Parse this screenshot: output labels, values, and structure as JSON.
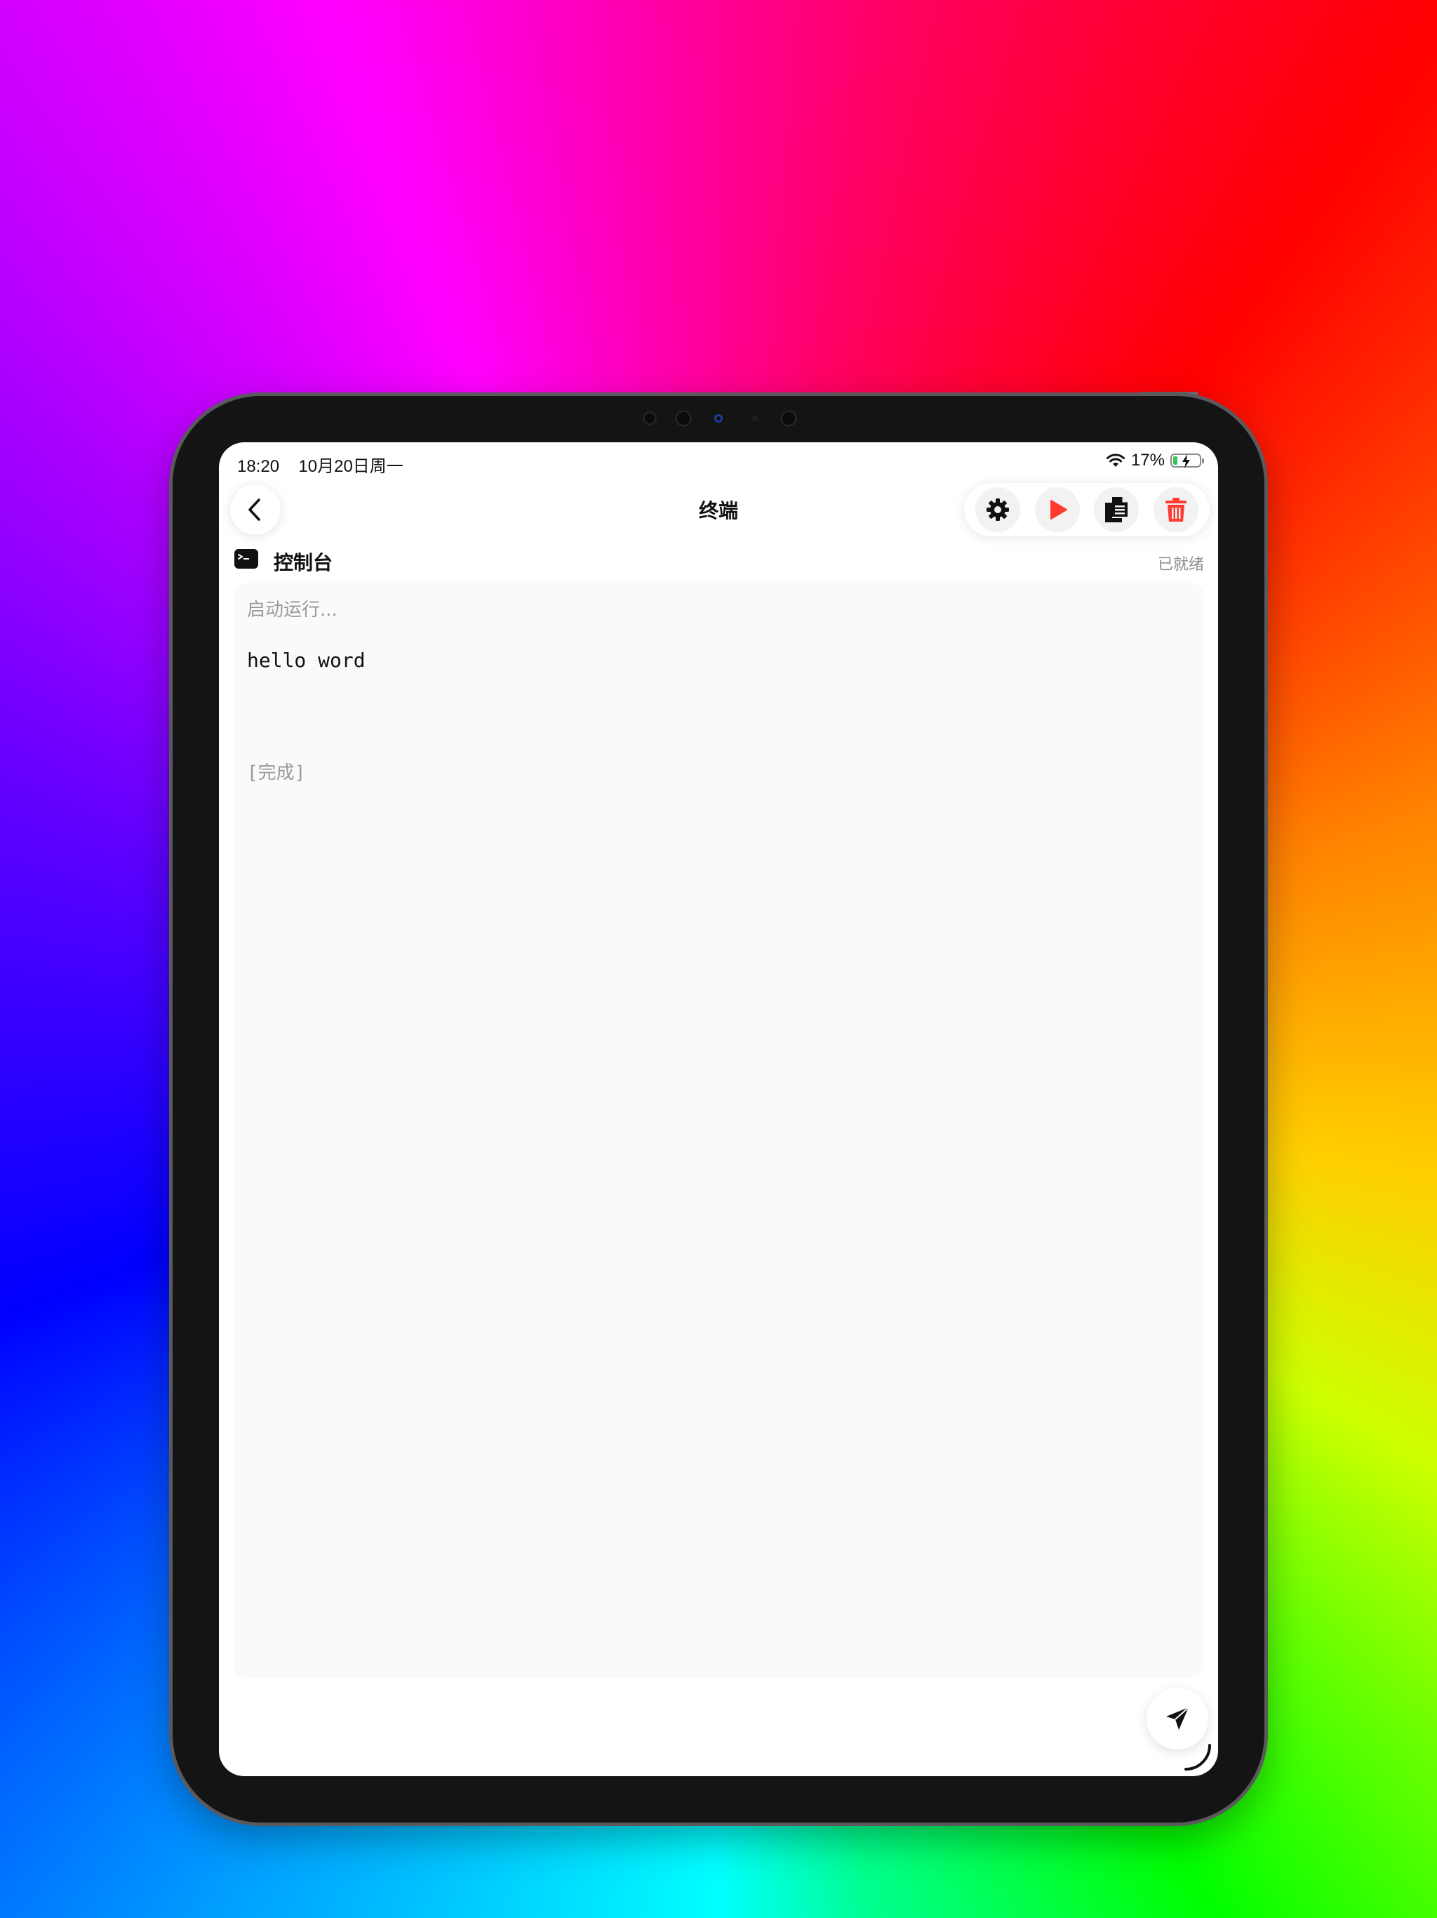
{
  "status_bar": {
    "time": "18:20",
    "date": "10月20日周一",
    "battery_percent": "17%",
    "battery_level": 0.17,
    "charging": true
  },
  "nav": {
    "title": "终端",
    "back_icon": "chevron-left-icon"
  },
  "toolbar": {
    "items": [
      {
        "name": "settings-button",
        "icon": "gear-icon",
        "color": "#111111"
      },
      {
        "name": "run-button",
        "icon": "play-icon",
        "color": "#ff3b30"
      },
      {
        "name": "copy-button",
        "icon": "copy-icon",
        "color": "#111111"
      },
      {
        "name": "clear-button",
        "icon": "trash-icon",
        "color": "#ff3b30"
      }
    ]
  },
  "console": {
    "title": "控制台",
    "status": "已就绪",
    "icon": "terminal-icon",
    "lines": {
      "start": "启动运行...",
      "output": "hello word",
      "done": "[完成]"
    }
  },
  "send": {
    "icon": "send-icon"
  },
  "colors": {
    "accent_red": "#ff3b30",
    "battery_green": "#34c759",
    "panel_bg": "#fafafa"
  }
}
